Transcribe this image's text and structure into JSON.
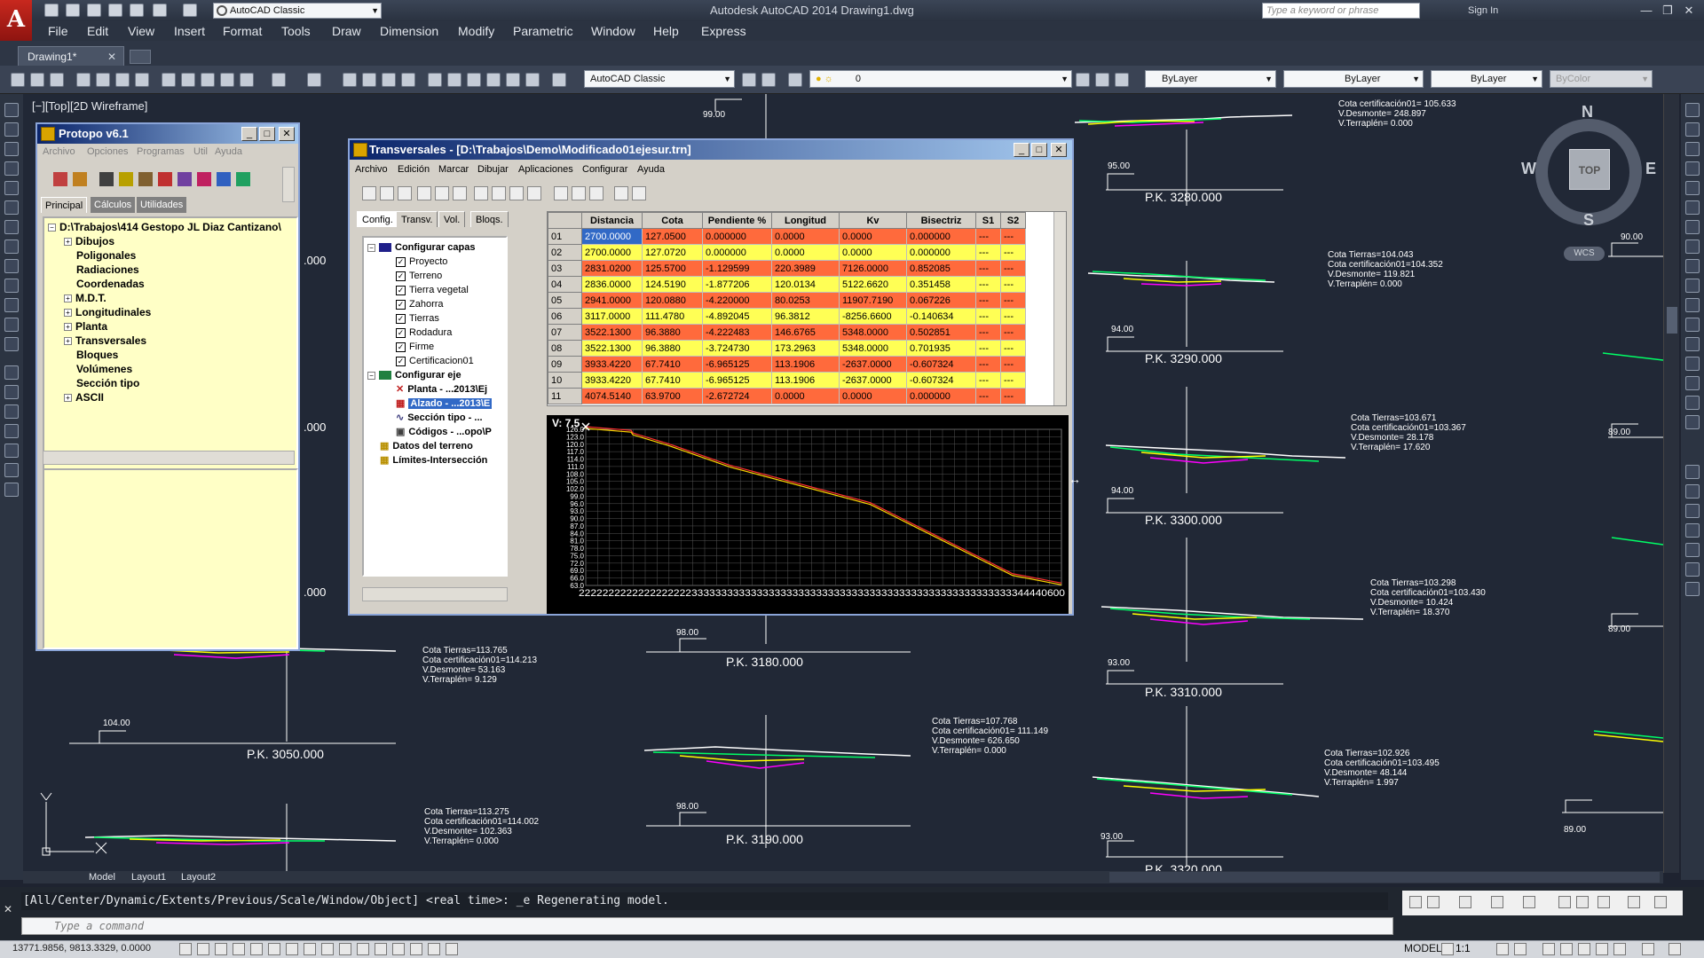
{
  "app": {
    "title": "Autodesk AutoCAD 2014    Drawing1.dwg",
    "workspace": "AutoCAD Classic",
    "search_placeholder": "Type a keyword or phrase",
    "sign_in": "Sign In"
  },
  "menu": [
    "File",
    "Edit",
    "View",
    "Insert",
    "Format",
    "Tools",
    "Draw",
    "Dimension",
    "Modify",
    "Parametric",
    "Window",
    "Help",
    "Express"
  ],
  "doc_tab": "Drawing1*",
  "toolbar": {
    "workspace_combo": "AutoCAD Classic",
    "layer_combo": "0",
    "color_combo": "ByLayer",
    "linetype_combo": "ByLayer",
    "lineweight_combo": "ByLayer",
    "plotstyle_combo": "ByColor"
  },
  "viewport_label": "[−][Top][2D Wireframe]",
  "viewcube": {
    "n": "N",
    "s": "S",
    "e": "E",
    "w": "W",
    "top": "TOP",
    "wcs": "WCS"
  },
  "drawing": {
    "pk_labels": [
      "P.K. 3280.000",
      "P.K. 3290.000",
      "P.K. 3300.000",
      "P.K. 3310.000",
      "P.K. 3320.000",
      "P.K. 3180.000",
      "P.K. 3190.000",
      "P.K. 3050.000"
    ],
    "elev_labels": [
      "99.00",
      "95.00",
      "94.00",
      "94.00",
      "93.00",
      "93.00",
      "98.00",
      "98.00",
      "104.00",
      "90.00",
      "89.00",
      "89.00",
      "89.00"
    ],
    "left_numbers": [
      ".000",
      ".000",
      ".000"
    ],
    "info_blocks": [
      "Cota certificación01= 105.633\nV.Desmonte= 248.897\nV.Terraplén= 0.000",
      "Cota Tierras=104.043\nCota certificación01=104.352\nV.Desmonte= 119.821\nV.Terraplén= 0.000",
      "Cota Tierras=103.671\nCota certificación01=103.367\nV.Desmonte= 28.178\nV.Terraplén= 17.620",
      "Cota Tierras=103.298\nCota certificación01=103.430\nV.Desmonte= 10.424\nV.Terraplén= 18.370",
      "Cota Tierras=102.926\nCota certificación01=103.495\nV.Desmonte= 48.144\nV.Terraplén= 1.997",
      "Cota Tierras=113.765\nCota certificación01=114.213\nV.Desmonte= 53.163\nV.Terraplén= 9.129",
      "Cota Tierras=107.768\nCota certificación01= 111.149\nV.Desmonte= 626.650\nV.Terraplén= 0.000",
      "Cota Tierras=113.275\nCota certificación01=114.002\nV.Desmonte= 102.363\nV.Terraplén= 0.000"
    ]
  },
  "layout_tabs": [
    "Model",
    "Layout1",
    "Layout2"
  ],
  "command": {
    "history": "[All/Center/Dynamic/Extents/Previous/Scale/Window/Object] <real time>: _e Regenerating model.",
    "placeholder": "Type a command"
  },
  "status": {
    "coords": "13771.9856, 9813.3329, 0.0000",
    "model": "MODEL",
    "scale": "1:1"
  },
  "protopo": {
    "title": "Protopo v6.1",
    "menu": [
      "Archivo",
      "Opciones",
      "Programas",
      "Util",
      "Ayuda"
    ],
    "tabs": [
      "Principal",
      "Cálculos",
      "Utilidades"
    ],
    "root": "D:\\Trabajos\\414 Gestopo JL Diaz Cantizano\\",
    "tree": [
      "Dibujos",
      "Poligonales",
      "Radiaciones",
      "Coordenadas",
      "M.D.T.",
      "Longitudinales",
      "Planta",
      "Transversales",
      "Bloques",
      "Volúmenes",
      "Sección tipo",
      "ASCII"
    ]
  },
  "transversales": {
    "title": "Transversales - [D:\\Trabajos\\Demo\\Modificado01ejesur.trn]",
    "menu": [
      "Archivo",
      "Edición",
      "Marcar",
      "Dibujar",
      "Aplicaciones",
      "Configurar",
      "Ayuda"
    ],
    "tabs": [
      "Config.",
      "Transv.",
      "Vol.",
      "Bloqs."
    ],
    "tree": {
      "capas_header": "Configurar capas",
      "capas": [
        "Proyecto",
        "Terreno",
        "Tierra vegetal",
        "Zahorra",
        "Tierras",
        "Rodadura",
        "Firme",
        "Certificacion01"
      ],
      "eje_header": "Configurar eje",
      "eje": [
        "Planta - ...2013\\Ej",
        "Alzado - ...2013\\E",
        "Sección tipo - ...",
        "Códigos - ...opo\\P"
      ],
      "datos": "Datos del terreno",
      "limites": "Límites-Intersección"
    },
    "columns": [
      "Distancia",
      "Cota",
      "Pendiente %",
      "Longitud",
      "Kv",
      "Bisectriz",
      "S1",
      "S2"
    ],
    "rows": [
      [
        "01",
        "2700.0000",
        "127.0500",
        "0.000000",
        "0.0000",
        "0.0000",
        "0.000000",
        "---",
        "---"
      ],
      [
        "02",
        "2700.0000",
        "127.0720",
        "0.000000",
        "0.0000",
        "0.0000",
        "0.000000",
        "---",
        "---"
      ],
      [
        "03",
        "2831.0200",
        "125.5700",
        "-1.129599",
        "220.3989",
        "7126.0000",
        "0.852085",
        "---",
        "---"
      ],
      [
        "04",
        "2836.0000",
        "124.5190",
        "-1.877206",
        "120.0134",
        "5122.6620",
        "0.351458",
        "---",
        "---"
      ],
      [
        "05",
        "2941.0000",
        "120.0880",
        "-4.220000",
        "80.0253",
        "11907.7190",
        "0.067226",
        "---",
        "---"
      ],
      [
        "06",
        "3117.0000",
        "111.4780",
        "-4.892045",
        "96.3812",
        "-8256.6600",
        "-0.140634",
        "---",
        "---"
      ],
      [
        "07",
        "3522.1300",
        "96.3880",
        "-4.222483",
        "146.6765",
        "5348.0000",
        "0.502851",
        "---",
        "---"
      ],
      [
        "08",
        "3522.1300",
        "96.3880",
        "-3.724730",
        "173.2963",
        "5348.0000",
        "0.701935",
        "---",
        "---"
      ],
      [
        "09",
        "3933.4220",
        "67.7410",
        "-6.965125",
        "113.1906",
        "-2637.0000",
        "-0.607324",
        "---",
        "---"
      ],
      [
        "10",
        "3933.4220",
        "67.7410",
        "-6.965125",
        "113.1906",
        "-2637.0000",
        "-0.607324",
        "---",
        "---"
      ],
      [
        "11",
        "4074.5140",
        "63.9700",
        "-2.672724",
        "0.0000",
        "0.0000",
        "0.000000",
        "---",
        "---"
      ]
    ],
    "profile": {
      "v_label": "V: 7.5",
      "y_ticks": [
        "126.0",
        "123.0",
        "120.0",
        "117.0",
        "114.0",
        "111.0",
        "108.0",
        "105.0",
        "102.0",
        "99.0",
        "96.0",
        "93.0",
        "90.0",
        "87.0",
        "84.0",
        "81.0",
        "78.0",
        "75.0",
        "72.0",
        "69.0",
        "66.0",
        "63.0"
      ],
      "x_ticks": "2222222222222222222333333333333333333333333333333333333333333333333333333344440600"
    }
  }
}
